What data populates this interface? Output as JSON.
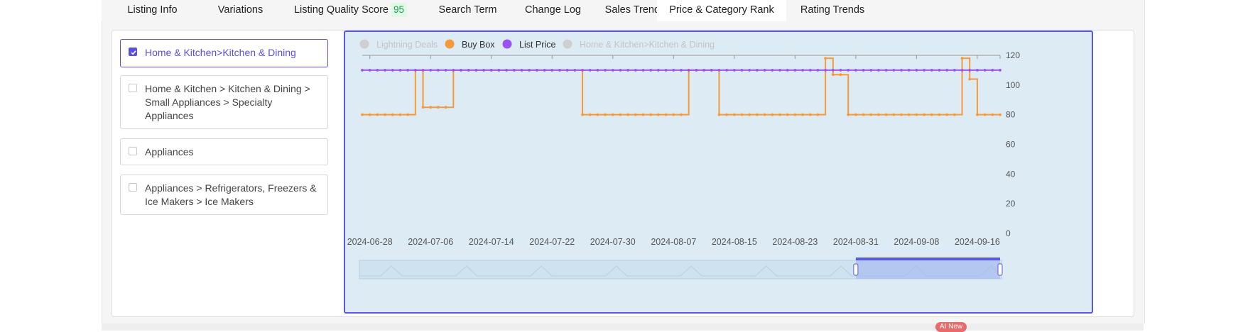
{
  "tabs": [
    {
      "label": "Listing Info"
    },
    {
      "label": "Variations"
    },
    {
      "label": "Listing Quality Score",
      "badge": "95"
    },
    {
      "label": "Search Term"
    },
    {
      "label": "Change Log"
    },
    {
      "label": "Sales Trends"
    },
    {
      "label": "Price & Category Rank",
      "active": true
    },
    {
      "label": "Rating Trends"
    }
  ],
  "categories": [
    {
      "label": "Home & Kitchen>Kitchen & Dining",
      "checked": true
    },
    {
      "label": "Home & Kitchen > Kitchen & Dining > Small Appliances > Specialty Appliances",
      "checked": false
    },
    {
      "label": "Appliances",
      "checked": false
    },
    {
      "label": "Appliances > Refrigerators, Freezers & Ice Makers > Ice Makers",
      "checked": false
    }
  ],
  "badge": {
    "label": "AI New"
  },
  "colors": {
    "accent": "#5a4fe0",
    "buy_box": "#f59a3c",
    "list_price": "#9a52f0",
    "inactive": "#cfcfcf",
    "badge_green": "#1aa14a"
  },
  "chart_data": {
    "type": "line",
    "legend": [
      {
        "name": "Lightning Deals",
        "active": false,
        "color": "#cfcfcf"
      },
      {
        "name": "Buy Box",
        "active": true,
        "color": "#f59a3c"
      },
      {
        "name": "List Price",
        "active": true,
        "color": "#9a52f0"
      },
      {
        "name": "Home & Kitchen>Kitchen & Dining",
        "active": false,
        "color": "#cfcfcf"
      }
    ],
    "x_tick_labels": [
      "2024-06-28",
      "2024-07-06",
      "2024-07-14",
      "2024-07-22",
      "2024-07-30",
      "2024-08-07",
      "2024-08-15",
      "2024-08-23",
      "2024-08-31",
      "2024-09-08",
      "2024-09-16"
    ],
    "x_range": [
      "2024-06-27",
      "2024-09-19"
    ],
    "y_tick_labels": [
      "0",
      "20",
      "40",
      "60",
      "80",
      "100",
      "120"
    ],
    "ylim": [
      0,
      120
    ],
    "y_axis_side": "right",
    "series": [
      {
        "name": "Buy Box",
        "step": true,
        "points": [
          [
            "2024-06-27",
            80
          ],
          [
            "2024-07-04",
            110
          ],
          [
            "2024-07-05",
            85
          ],
          [
            "2024-07-09",
            110
          ],
          [
            "2024-07-26",
            80
          ],
          [
            "2024-08-09",
            110
          ],
          [
            "2024-08-13",
            80
          ],
          [
            "2024-08-27",
            118
          ],
          [
            "2024-08-28",
            107
          ],
          [
            "2024-08-30",
            80
          ],
          [
            "2024-09-14",
            118
          ],
          [
            "2024-09-15",
            104
          ],
          [
            "2024-09-16",
            80
          ],
          [
            "2024-09-19",
            80
          ]
        ]
      },
      {
        "name": "List Price",
        "step": false,
        "points": [
          [
            "2024-06-27",
            110
          ],
          [
            "2024-09-19",
            110
          ]
        ]
      }
    ],
    "zoom_window": {
      "start": "2024-08-31",
      "end": "2024-09-19"
    }
  }
}
